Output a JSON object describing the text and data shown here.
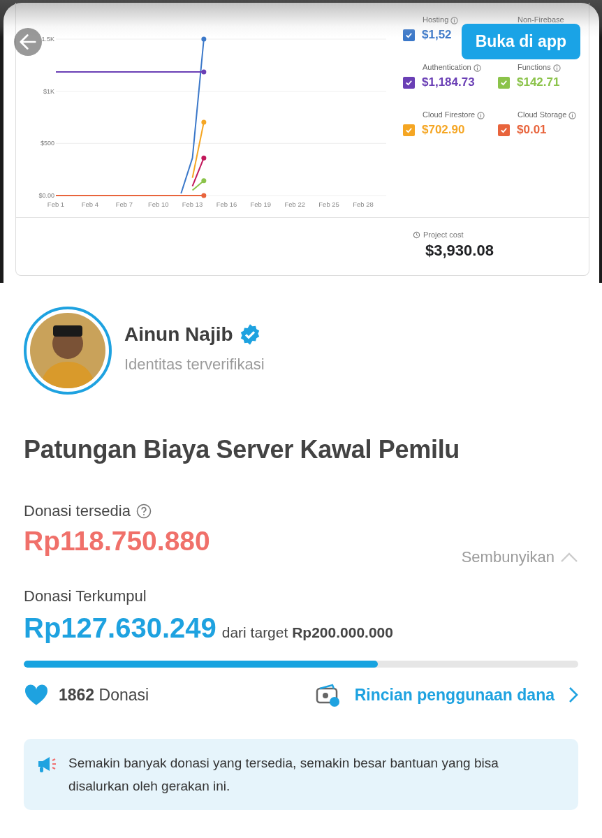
{
  "header": {
    "action": "Buka di app"
  },
  "cost_chart": {
    "chart_data": {
      "type": "line",
      "ylim": [
        0,
        1500
      ],
      "grid": true,
      "categories": [
        "Feb 1",
        null,
        null,
        "Feb 4",
        null,
        null,
        "Feb 7",
        null,
        null,
        "Feb 10",
        null,
        null,
        "Feb 13",
        null,
        null,
        "Feb 16",
        null,
        null,
        "Feb 19",
        null,
        null,
        "Feb 22",
        null,
        null,
        "Feb 25",
        null,
        null,
        "Feb 28"
      ],
      "yticks": [
        {
          "value": 0,
          "label": "$0.00"
        },
        {
          "value": 500,
          "label": "$500"
        },
        {
          "value": 1000,
          "label": "$1K"
        },
        {
          "value": 1500,
          "label": "1.5K"
        }
      ],
      "series": [
        {
          "name": "Hosting",
          "color": "#3b78c9",
          "values": [
            null,
            null,
            null,
            null,
            null,
            null,
            null,
            null,
            null,
            null,
            null,
            20,
            360,
            1500,
            null,
            null,
            null,
            null,
            null,
            null,
            null,
            null,
            null,
            null,
            null,
            null,
            null,
            null
          ]
        },
        {
          "name": "Authentication",
          "color": "#6a3fb5",
          "values": [
            1185,
            1185,
            1185,
            1185,
            1185,
            1185,
            1185,
            1185,
            1185,
            1185,
            1185,
            1185,
            1185,
            1185,
            null,
            null,
            null,
            null,
            null,
            null,
            null,
            null,
            null,
            null,
            null,
            null,
            null,
            null
          ]
        },
        {
          "name": "Functions",
          "color": "#8bc34a",
          "values": [
            null,
            null,
            null,
            null,
            null,
            null,
            null,
            null,
            null,
            null,
            null,
            null,
            50,
            143,
            null,
            null,
            null,
            null,
            null,
            null,
            null,
            null,
            null,
            null,
            null,
            null,
            null,
            null
          ]
        },
        {
          "name": "Cloud Firestore",
          "color": "#f5a623",
          "values": [
            null,
            null,
            null,
            null,
            null,
            null,
            null,
            null,
            null,
            null,
            null,
            null,
            170,
            703,
            null,
            null,
            null,
            null,
            null,
            null,
            null,
            null,
            null,
            null,
            null,
            null,
            null,
            null
          ]
        },
        {
          "name": "Cloud Storage",
          "color": "#e8643c",
          "values": [
            0,
            0,
            0,
            0,
            0,
            0,
            0,
            0,
            0,
            0,
            0,
            0,
            0,
            0,
            null,
            null,
            null,
            null,
            null,
            null,
            null,
            null,
            null,
            null,
            null,
            null,
            null,
            null
          ]
        },
        {
          "name": "Non-Firebase",
          "color": "#c2185b",
          "values": [
            null,
            null,
            null,
            null,
            null,
            null,
            null,
            null,
            null,
            null,
            null,
            null,
            90,
            360,
            null,
            null,
            null,
            null,
            null,
            null,
            null,
            null,
            null,
            null,
            null,
            null,
            null,
            null
          ]
        }
      ]
    },
    "legend_totals": [
      {
        "value": "$1,52",
        "checked": true
      },
      {
        "value": "$1,184.73",
        "checked": true
      },
      {
        "value": "$142.71",
        "checked": true
      },
      {
        "value": "$702.90",
        "checked": true
      },
      {
        "value": "$0.01",
        "checked": true
      }
    ],
    "project_cost": {
      "label": "Project cost",
      "value": "$3,930.08"
    }
  },
  "campaigner": {
    "name": "Ainun Najib",
    "verified": true,
    "subtitle": "Identitas terverifikasi"
  },
  "title": "Patungan Biaya Server Kawal Pemilu",
  "available": {
    "label": "Donasi tersedia",
    "amount": "Rp118.750.880",
    "toggle": "Sembunyikan"
  },
  "collected": {
    "label": "Donasi Terkumpul",
    "amount": "Rp127.630.249",
    "target_prefix": "dari target",
    "target": "Rp200.000.000",
    "level": 0.638
  },
  "donations": {
    "count": "1862",
    "label": "Donasi"
  },
  "usage_link": "Rincian penggunaan dana",
  "notice": "Semakin banyak donasi yang tersedia, semakin besar bantuan yang bisa disalurkan oleh gerakan ini."
}
